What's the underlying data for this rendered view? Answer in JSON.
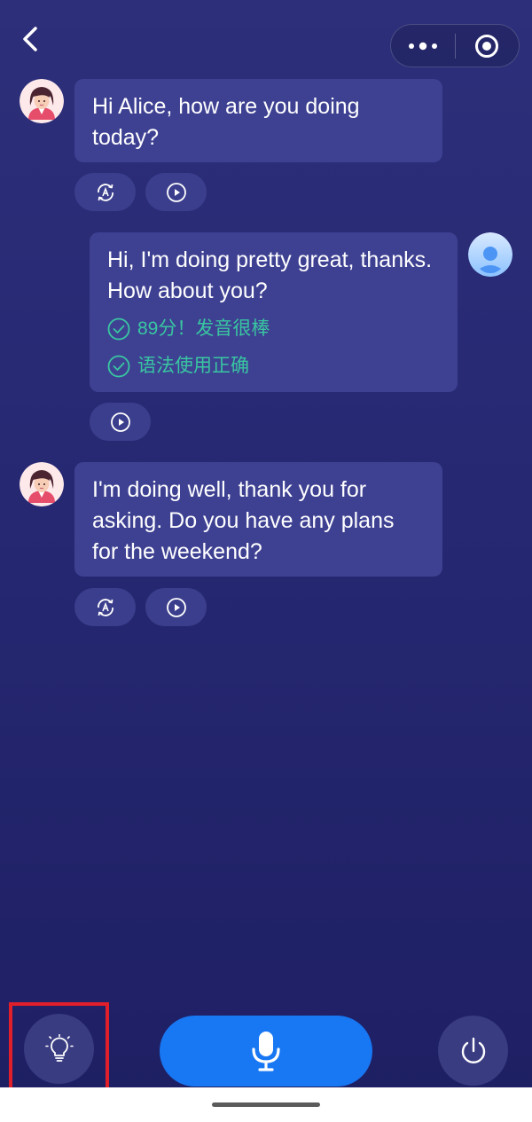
{
  "header": {
    "back_icon": "chevron-left-icon",
    "more_icon": "more-dots-icon",
    "close_icon": "target-circle-icon"
  },
  "messages": [
    {
      "role": "assistant",
      "avatar": "female-tutor-avatar",
      "text": "Hi Alice, how are you doing today?",
      "actions": [
        "translate-icon",
        "play-icon"
      ]
    },
    {
      "role": "user",
      "avatar": "user-avatar",
      "text": "Hi, I'm doing pretty great, thanks. How about you?",
      "feedback": [
        "89分！发音很棒",
        "语法使用正确"
      ],
      "actions": [
        "play-icon"
      ]
    },
    {
      "role": "assistant",
      "avatar": "female-tutor-avatar",
      "text": "I'm doing well, thank you for asking. Do you have any plans for the weekend?",
      "actions": [
        "translate-icon",
        "play-icon"
      ]
    }
  ],
  "controls": {
    "hint_icon": "lightbulb-icon",
    "mic_icon": "microphone-icon",
    "power_icon": "power-icon"
  },
  "colors": {
    "background": "#262872",
    "bubble": "#3e4192",
    "feedback": "#39c6a1",
    "mic_button": "#1877f2",
    "highlight": "#e01f2b"
  }
}
